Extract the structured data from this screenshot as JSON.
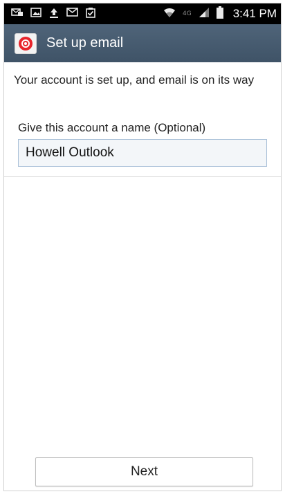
{
  "status_bar": {
    "time": "3:41 PM",
    "network_label": "4G",
    "icons": [
      "messages-icon",
      "image-icon",
      "upload-icon",
      "gmail-icon",
      "clipboard-check-icon",
      "wifi-icon",
      "signal-icon",
      "battery-icon"
    ]
  },
  "action_bar": {
    "title": "Set up email",
    "app_icon": "email-app-icon",
    "accent_color": "#e8242b"
  },
  "content": {
    "message": "Your account is set up, and email is on its way",
    "name_label": "Give this account a name (Optional)",
    "name_value": "Howell Outlook"
  },
  "footer": {
    "next_label": "Next"
  }
}
